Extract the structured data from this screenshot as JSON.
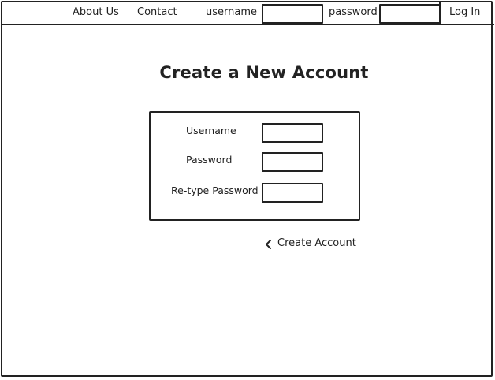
{
  "nav": {
    "about_label": "About Us",
    "contact_label": "Contact",
    "username_label": "username",
    "username_value": "",
    "password_label": "password",
    "password_value": "",
    "login_label": "Log In"
  },
  "main": {
    "title": "Create a New Account",
    "form": {
      "username_label": "Username",
      "username_value": "",
      "password_label": "Password",
      "password_value": "",
      "retype_label": "Re-type Password",
      "retype_value": ""
    },
    "create_account": {
      "icon": "chevron-left-icon",
      "label": "Create Account"
    }
  },
  "colors": {
    "stroke": "#222222",
    "background": "#ffffff"
  }
}
